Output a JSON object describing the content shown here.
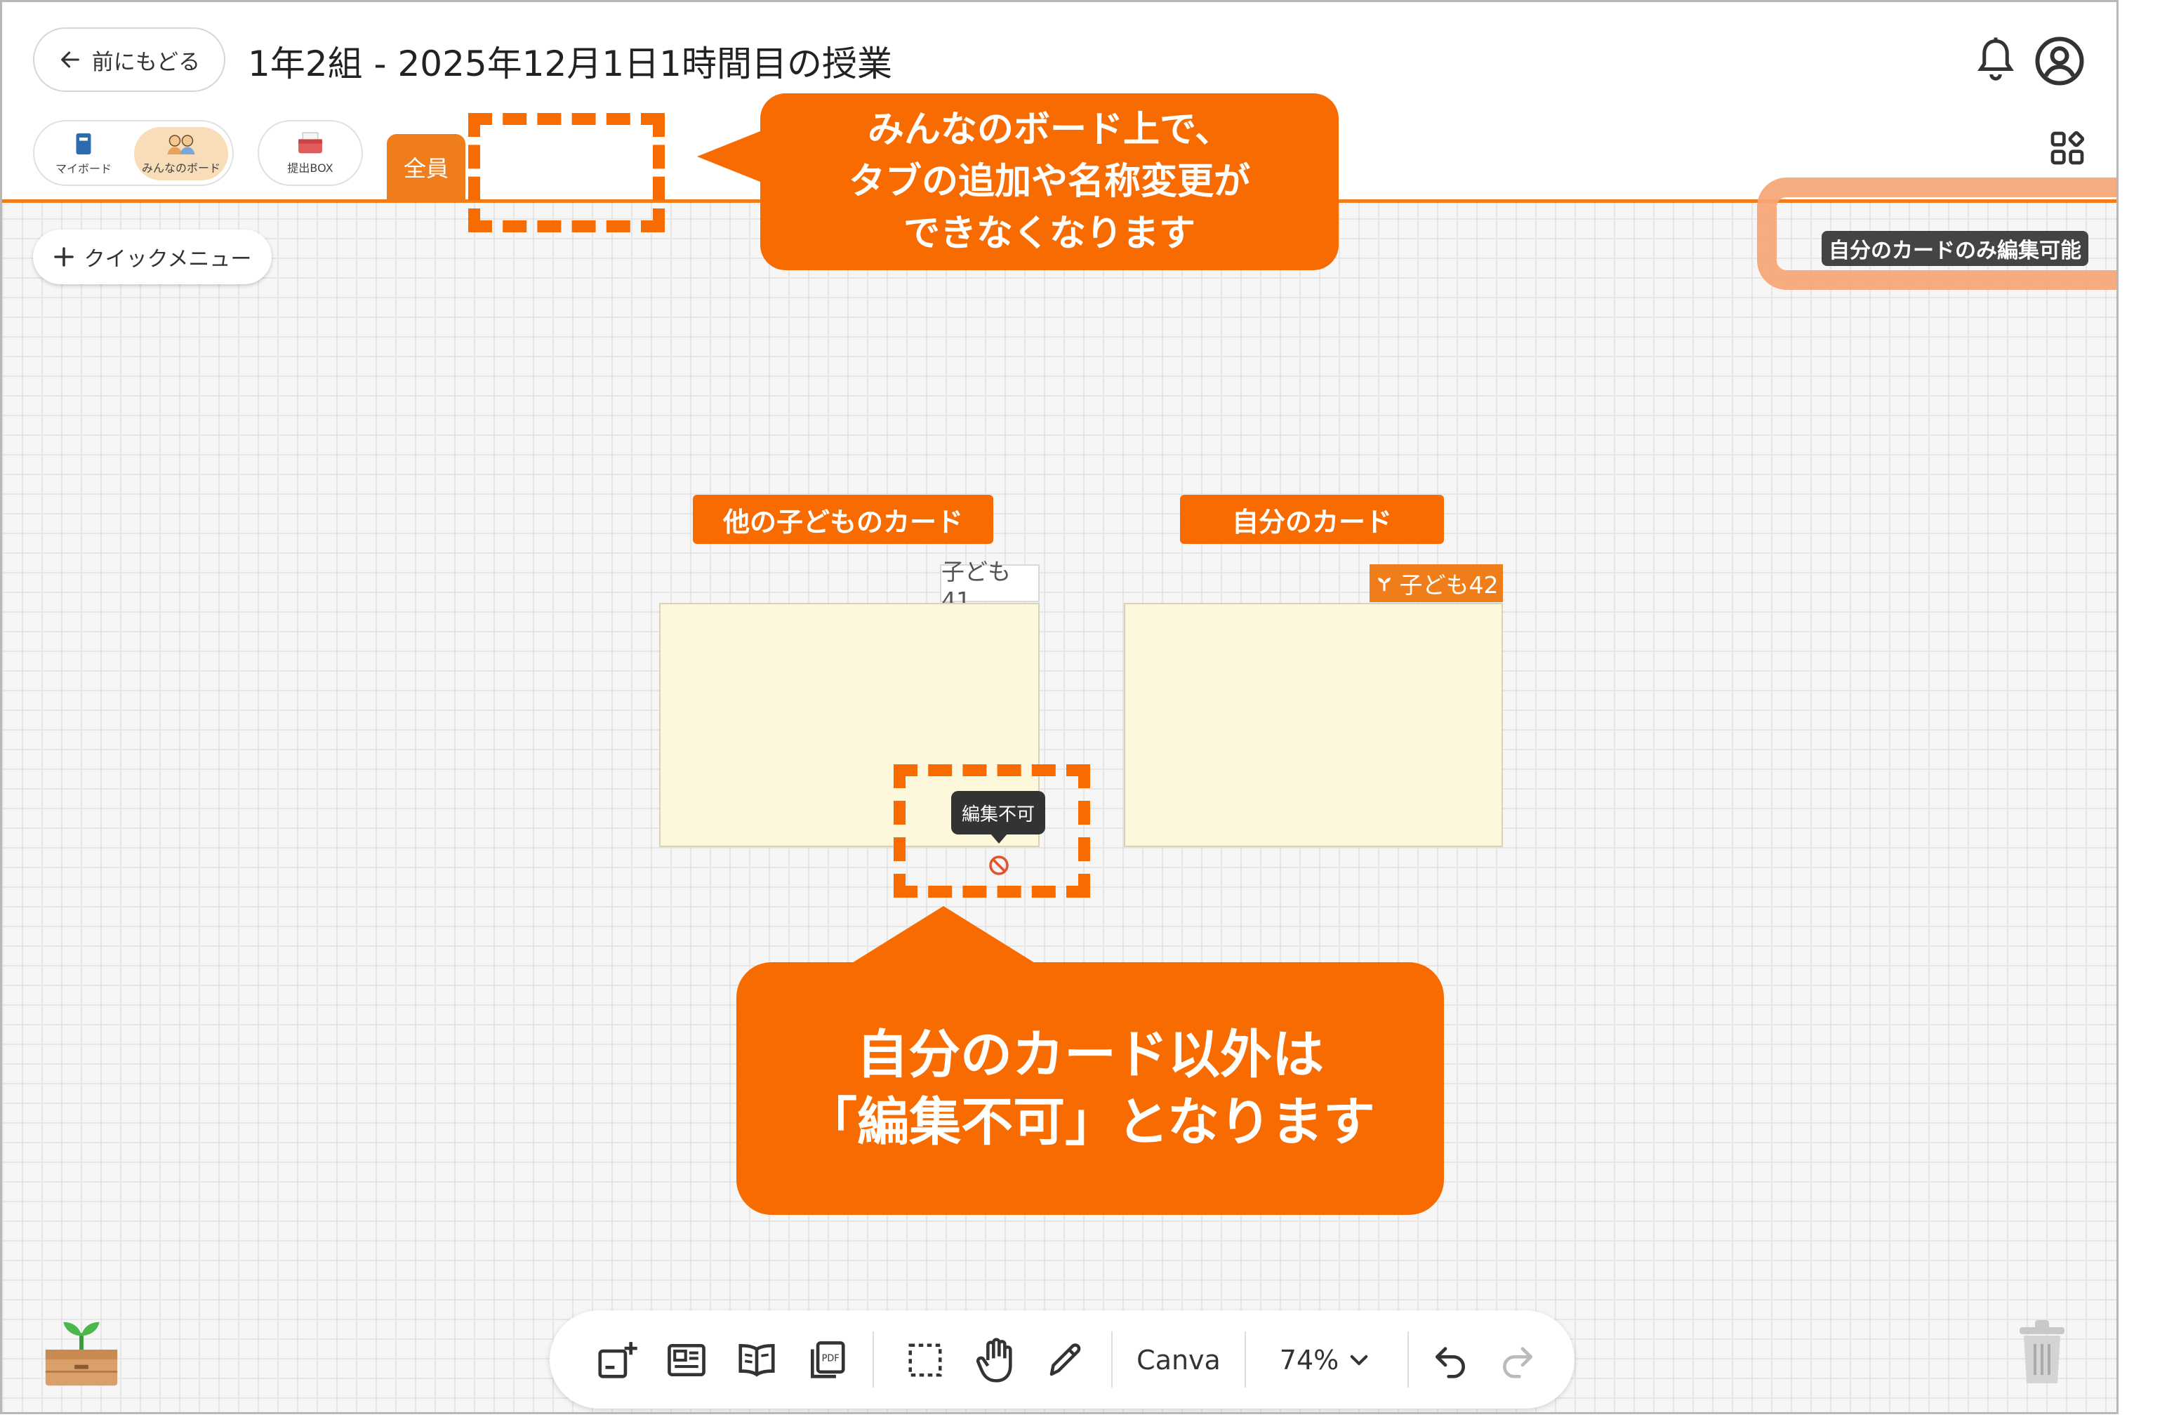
{
  "header": {
    "back_label": "前にもどる",
    "title": "1年2組 - 2025年12月1日1時間目の授業"
  },
  "board_switch": {
    "my_board": "マイボード",
    "everyone_board": "みんなのボード",
    "submit_box": "提出BOX"
  },
  "tabs": [
    {
      "label": "全員"
    }
  ],
  "quick_menu": {
    "label": "クイックメニュー"
  },
  "edit_badge": {
    "label": "自分のカードのみ編集可能"
  },
  "callouts": {
    "top": [
      "みんなのボード上で、",
      "タブの追加や名称変更が",
      "できなくなります"
    ],
    "bottom": [
      "自分のカード以外は",
      "「編集不可」となります"
    ]
  },
  "cards": [
    {
      "label": "他の子どものカード",
      "owner": "子ども41",
      "mine": false
    },
    {
      "label": "自分のカード",
      "owner": "子ども42",
      "mine": true
    }
  ],
  "tooltip": {
    "label": "編集不可"
  },
  "toolbar": {
    "canva": "Canva",
    "zoom": "74%"
  },
  "colors": {
    "accent_orange": "#ee7d1a",
    "callout_orange": "#f76b00",
    "card_bg": "#fdf7dc",
    "highlight": "#f6a877"
  },
  "icons": [
    "back-arrow-icon",
    "bell-icon",
    "user-icon",
    "apps-grid-icon",
    "plus-icon",
    "sprout-icon",
    "no-entry-icon",
    "add-card-icon",
    "card-layout-icon",
    "book-icon",
    "pdf-icon",
    "select-icon",
    "hand-icon",
    "pen-icon",
    "chevron-down-icon",
    "undo-icon",
    "redo-icon",
    "seedling-box-icon",
    "trash-icon"
  ]
}
